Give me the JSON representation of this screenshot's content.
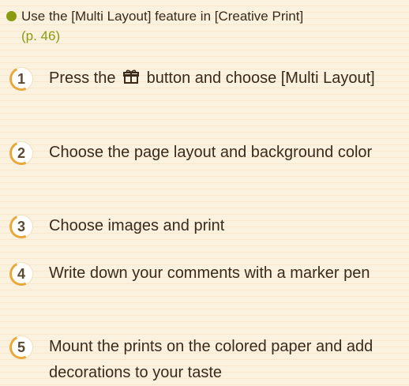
{
  "intro": {
    "text": "Use the [Multi Layout] feature in [Creative Print]",
    "ref": "(p. 46)"
  },
  "steps": [
    {
      "number": "1",
      "text_before": "Press the",
      "text_after": "button and choose [Multi Layout]",
      "icon": "gift-icon"
    },
    {
      "number": "2",
      "text": "Choose the page layout and background color"
    },
    {
      "number": "3",
      "text": "Choose images and print"
    },
    {
      "number": "4",
      "text": "Write down your comments with a marker pen"
    },
    {
      "number": "5",
      "text": "Mount the prints on the colored paper and add decorations to your taste"
    }
  ],
  "colors": {
    "accent_green": "#8a9b12",
    "step_ring": "#e9a83a",
    "background": "#fbf1df"
  }
}
